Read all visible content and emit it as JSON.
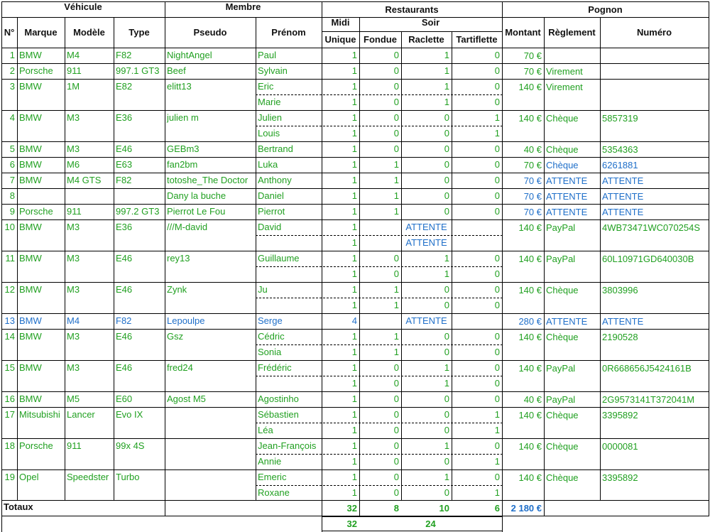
{
  "headers": {
    "group_vehicule": "Véhicule",
    "group_membre": "Membre",
    "group_restaurants": "Restaurants",
    "group_pognon": "Pognon",
    "midi": "Midi",
    "soir": "Soir",
    "cols": {
      "num": "N°",
      "marque": "Marque",
      "modele": "Modèle",
      "type": "Type",
      "pseudo": "Pseudo",
      "prenom": "Prénom",
      "unique": "Unique",
      "fondue": "Fondue",
      "raclette": "Raclette",
      "tartiflette": "Tartiflette",
      "montant": "Montant",
      "reglement": "Règlement",
      "numero": "Numéro"
    }
  },
  "colors": {
    "green": "#21a021",
    "blue": "#1f6fc9"
  },
  "lines": [
    {
      "num": "1",
      "marque": "BMW",
      "modele": "M4",
      "type": "F82",
      "pseudo": "NightAngel",
      "prenom": "Paul",
      "unique": "1",
      "fondue": "0",
      "raclette": "1",
      "tartiflette": "0",
      "montant": "70 €",
      "reglement": "",
      "numero": ""
    },
    {
      "num": "2",
      "marque": "Porsche",
      "modele": "911",
      "type": "997.1 GT3",
      "pseudo": "Beef",
      "prenom": "Sylvain",
      "unique": "1",
      "fondue": "0",
      "raclette": "1",
      "tartiflette": "0",
      "montant": "70 €",
      "reglement": "Virement",
      "numero": ""
    },
    {
      "num": "3",
      "marque": "BMW",
      "modele": "1M",
      "type": "E82",
      "pseudo": "elitt13",
      "prenom": "Eric",
      "unique": "1",
      "fondue": "0",
      "raclette": "1",
      "tartiflette": "0",
      "montant": "140 €",
      "reglement": "Virement",
      "numero": ""
    },
    {
      "prenom": "Marie",
      "unique": "1",
      "fondue": "0",
      "raclette": "1",
      "tartiflette": "0"
    },
    {
      "num": "4",
      "marque": "BMW",
      "modele": "M3",
      "type": "E36",
      "pseudo": "julien m",
      "prenom": "Julien",
      "unique": "1",
      "fondue": "0",
      "raclette": "0",
      "tartiflette": "1",
      "montant": "140 €",
      "reglement": "Chèque",
      "numero": "5857319"
    },
    {
      "prenom": "Louis",
      "unique": "1",
      "fondue": "0",
      "raclette": "0",
      "tartiflette": "1"
    },
    {
      "num": "5",
      "marque": "BMW",
      "modele": "M3",
      "type": "E46",
      "pseudo": "GEBm3",
      "prenom": "Bertrand",
      "unique": "1",
      "fondue": "0",
      "raclette": "0",
      "tartiflette": "0",
      "montant": "40 €",
      "reglement": "Chèque",
      "numero": "5354363"
    },
    {
      "num": "6",
      "marque": "BMW",
      "modele": "M6",
      "type": "E63",
      "pseudo": "fan2bm",
      "prenom": "Luka",
      "unique": "1",
      "fondue": "1",
      "raclette": "0",
      "tartiflette": "0",
      "montant": "70 €",
      "reglement": "Chèque",
      "numero": "6261881"
    },
    {
      "num": "7",
      "marque": "BMW",
      "modele": "M4 GTS",
      "type": "F82",
      "pseudo": "totoshe_The Doctor",
      "prenom": "Anthony",
      "unique": "1",
      "fondue": "1",
      "raclette": "0",
      "tartiflette": "0",
      "montant": "70 €",
      "reglement": "ATTENTE",
      "numero": "ATTENTE"
    },
    {
      "num": "8",
      "pseudo": "Dany la buche",
      "prenom": "Daniel",
      "unique": "1",
      "fondue": "1",
      "raclette": "0",
      "tartiflette": "0",
      "montant": "70 €",
      "reglement": "ATTENTE",
      "numero": "ATTENTE"
    },
    {
      "num": "9",
      "marque": "Porsche",
      "modele": "911",
      "type": "997.2 GT3",
      "pseudo": "Pierrot Le Fou",
      "prenom": "Pierrot",
      "unique": "1",
      "fondue": "1",
      "raclette": "0",
      "tartiflette": "0",
      "montant": "70 €",
      "reglement": "ATTENTE",
      "numero": "ATTENTE"
    },
    {
      "num": "10",
      "marque": "BMW",
      "modele": "M3",
      "type": "E36",
      "pseudo": "///M-david",
      "prenom": "David",
      "unique": "1",
      "soir_attente": "ATTENTE",
      "montant": "140 €",
      "reglement": "PayPal",
      "numero": "4WB73471WC070254S"
    },
    {
      "unique": "1",
      "soir_attente": "ATTENTE"
    },
    {
      "num": "11",
      "marque": "BMW",
      "modele": "M3",
      "type": "E46",
      "pseudo": "rey13",
      "prenom": "Guillaume",
      "unique": "1",
      "fondue": "0",
      "raclette": "1",
      "tartiflette": "0",
      "montant": "140 €",
      "reglement": "PayPal",
      "numero": "60L10971GD640030B"
    },
    {
      "unique": "1",
      "fondue": "0",
      "raclette": "1",
      "tartiflette": "0"
    },
    {
      "num": "12",
      "marque": "BMW",
      "modele": "M3",
      "type": "E46",
      "pseudo": "Zynk",
      "prenom": "Ju",
      "unique": "1",
      "fondue": "1",
      "raclette": "0",
      "tartiflette": "0",
      "montant": "140 €",
      "reglement": "Chèque",
      "numero": "3803996"
    },
    {
      "unique": "1",
      "fondue": "1",
      "raclette": "0",
      "tartiflette": "0"
    },
    {
      "num": "13",
      "marque": "BMW",
      "modele": "M4",
      "type": "F82",
      "pseudo": "Lepoulpe",
      "prenom": "Serge",
      "unique": "4",
      "soir_attente": "ATTENTE",
      "montant": "280 €",
      "reglement": "ATTENTE",
      "numero": "ATTENTE"
    },
    {
      "num": "14",
      "marque": "BMW",
      "modele": "M3",
      "type": "E46",
      "pseudo": "Gsz",
      "prenom": "Cédric",
      "unique": "1",
      "fondue": "1",
      "raclette": "0",
      "tartiflette": "0",
      "montant": "140 €",
      "reglement": "Chèque",
      "numero": "2190528"
    },
    {
      "prenom": "Sonia",
      "unique": "1",
      "fondue": "1",
      "raclette": "0",
      "tartiflette": "0"
    },
    {
      "num": "15",
      "marque": "BMW",
      "modele": "M3",
      "type": "E46",
      "pseudo": "fred24",
      "prenom": "Frédéric",
      "unique": "1",
      "fondue": "0",
      "raclette": "1",
      "tartiflette": "0",
      "montant": "140 €",
      "reglement": "PayPal",
      "numero": "0R668656J5424161B"
    },
    {
      "unique": "1",
      "fondue": "0",
      "raclette": "1",
      "tartiflette": "0"
    },
    {
      "num": "16",
      "marque": "BMW",
      "modele": "M5",
      "type": "E60",
      "pseudo": "Agost M5",
      "prenom": "Agostinho",
      "unique": "1",
      "fondue": "0",
      "raclette": "0",
      "tartiflette": "0",
      "montant": "40 €",
      "reglement": "PayPal",
      "numero": "2G9573141T372041M"
    },
    {
      "num": "17",
      "marque": "Mitsubishi",
      "modele": "Lancer",
      "type": "Evo IX",
      "prenom": "Sébastien",
      "unique": "1",
      "fondue": "0",
      "raclette": "0",
      "tartiflette": "1",
      "montant": "140 €",
      "reglement": "Chèque",
      "numero": "3395892"
    },
    {
      "prenom": "Léa",
      "unique": "1",
      "fondue": "0",
      "raclette": "0",
      "tartiflette": "1"
    },
    {
      "num": "18",
      "marque": "Porsche",
      "modele": "911",
      "type": "99x 4S",
      "prenom": "Jean-François",
      "unique": "1",
      "fondue": "0",
      "raclette": "1",
      "tartiflette": "0",
      "montant": "140 €",
      "reglement": "Chèque",
      "numero": "0000081"
    },
    {
      "prenom": "Annie",
      "unique": "1",
      "fondue": "0",
      "raclette": "0",
      "tartiflette": "1"
    },
    {
      "num": "19",
      "marque": "Opel",
      "modele": "Speedster",
      "type": "Turbo",
      "prenom": "Emeric",
      "unique": "1",
      "fondue": "0",
      "raclette": "1",
      "tartiflette": "0",
      "montant": "140 €",
      "reglement": "Chèque",
      "numero": "3395892"
    },
    {
      "prenom": "Roxane",
      "unique": "1",
      "fondue": "0",
      "raclette": "0",
      "tartiflette": "1"
    }
  ],
  "totals": {
    "label": "Totaux",
    "unique": "32",
    "fondue": "8",
    "raclette": "10",
    "tartiflette": "6",
    "montant": "2 180 €",
    "midi_total": "32",
    "soir_total": "24"
  }
}
